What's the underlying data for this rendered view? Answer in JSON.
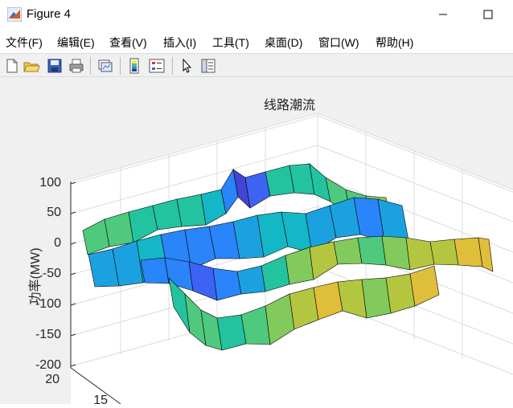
{
  "window": {
    "title": "Figure 4"
  },
  "menu": {
    "items": [
      {
        "label": "文件(F)"
      },
      {
        "label": "编辑(E)"
      },
      {
        "label": "查看(V)"
      },
      {
        "label": "插入(I)"
      },
      {
        "label": "工具(T)"
      },
      {
        "label": "桌面(D)"
      },
      {
        "label": "窗口(W)"
      },
      {
        "label": "帮助(H)"
      }
    ]
  },
  "toolbar": {
    "buttons": [
      "new-figure-icon",
      "open-file-icon",
      "save-icon",
      "print-icon",
      "link-plot-icon",
      "insert-colorbar-icon",
      "insert-legend-icon",
      "pointer-icon",
      "property-editor-icon"
    ]
  },
  "chart_data": {
    "type": "surface",
    "title": "线路潮流",
    "zlabel": "功率(MW)",
    "zlim": [
      -200,
      100
    ],
    "z_ticks": [
      "100",
      "50",
      "0",
      "-50",
      "-100",
      "-150",
      "-200"
    ],
    "y_ticks": [
      "20",
      "15"
    ],
    "colormap": "parula",
    "edgecolor": "#000000"
  }
}
